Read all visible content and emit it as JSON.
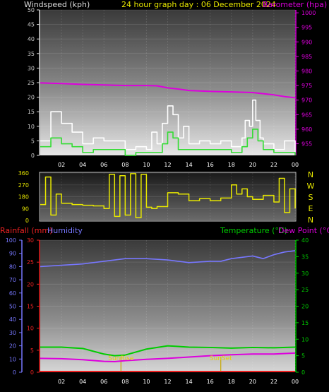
{
  "header": {
    "windspeed_label": "Windspeed (kph)",
    "title": "24 hour graph day : 06 December 2024",
    "barometer_label": "Barometer (hpa)",
    "rainfall_label": "Rainfall (mm)",
    "humidity_label": "Humidity",
    "temperature_label": "Temperature (°C)",
    "dewpoint_label": "Dew Point (°C)"
  },
  "compass_labels": [
    "N",
    "W",
    "S",
    "E",
    "N"
  ],
  "sun_labels": {
    "sunrise": "SunRise",
    "sunset": "SunSet"
  },
  "colors": {
    "wind": "#ffffff",
    "wind_avg": "#33dd33",
    "barometer": "#dd00dd",
    "direction": "#e8e800",
    "rain": "#ee2222",
    "humidity": "#7777ff",
    "temperature": "#00cc00",
    "dewpoint": "#dd00dd",
    "header_wind": "#dddddd",
    "header_title": "#e8e800"
  },
  "chart_data": [
    {
      "type": "line",
      "x_ticks": [
        "02",
        "04",
        "06",
        "08",
        "10",
        "12",
        "14",
        "16",
        "18",
        "20",
        "22",
        "00"
      ],
      "x_hours": [
        2,
        4,
        6,
        8,
        10,
        12,
        14,
        16,
        18,
        20,
        22,
        24
      ],
      "y_left_ticks": [
        "0",
        "5",
        "10",
        "15",
        "20",
        "25",
        "30",
        "35",
        "40",
        "45",
        "50"
      ],
      "y_left_range": [
        0,
        50
      ],
      "y_right_ticks": [
        "955",
        "960",
        "965",
        "970",
        "975",
        "980",
        "985",
        "990",
        "995",
        "1000"
      ],
      "y_right_range": [
        951,
        1001
      ],
      "grid": true,
      "series": [
        {
          "name": "Windspeed (kph)",
          "axis": "left",
          "x": [
            0,
            1,
            2,
            3,
            4,
            5,
            6,
            7,
            8,
            9,
            10,
            10.5,
            11,
            11.5,
            12,
            12.5,
            13,
            13.5,
            14,
            15,
            16,
            17,
            18,
            19,
            19.3,
            19.7,
            20,
            20.3,
            20.7,
            21,
            22,
            23,
            24
          ],
          "values": [
            5,
            15,
            11,
            8,
            4,
            6,
            5,
            5,
            2,
            3,
            2,
            8,
            4,
            11,
            17,
            14,
            6,
            10,
            4,
            5,
            4,
            5,
            3,
            6,
            12,
            10,
            19,
            12,
            6,
            4,
            2,
            5,
            1
          ]
        },
        {
          "name": "Wind average",
          "axis": "left",
          "x": [
            0,
            1,
            2,
            3,
            4,
            5,
            6,
            7,
            8,
            9,
            10,
            11,
            11.5,
            12,
            12.5,
            13,
            14,
            15,
            16,
            17,
            18,
            19,
            19.5,
            20,
            20.5,
            21,
            22,
            23,
            24
          ],
          "values": [
            3,
            6,
            4,
            3,
            1,
            2,
            2,
            2,
            0,
            1,
            1,
            1,
            4,
            8,
            6,
            2,
            2,
            2,
            2,
            2,
            1,
            3,
            6,
            9,
            5,
            2,
            1,
            1,
            0
          ]
        },
        {
          "name": "Barometer (hpa)",
          "axis": "right",
          "x": [
            0,
            2,
            4,
            6,
            8,
            10,
            11,
            12,
            13,
            14,
            16,
            18,
            20,
            22,
            23,
            24
          ],
          "values": [
            975.9,
            975.7,
            975.4,
            975.2,
            975,
            975,
            974.9,
            974.2,
            973.8,
            973.3,
            973,
            972.8,
            972.6,
            971.8,
            971.2,
            970.8
          ]
        }
      ]
    },
    {
      "type": "line",
      "x_ticks": [
        "02",
        "04",
        "06",
        "08",
        "10",
        "12",
        "14",
        "16",
        "18",
        "20",
        "22",
        "00"
      ],
      "y_left_ticks": [
        "0",
        "90",
        "180",
        "270",
        "360"
      ],
      "y_range": [
        0,
        360
      ],
      "series": [
        {
          "name": "Wind direction",
          "x": [
            0,
            0.5,
            1,
            1.5,
            2,
            3,
            4,
            5,
            6,
            6.5,
            7,
            7.5,
            8,
            8.5,
            9,
            9.5,
            10,
            10.5,
            11,
            12,
            13,
            14,
            15,
            16,
            17,
            18,
            18.5,
            19,
            19.5,
            20,
            21,
            22,
            22.5,
            23,
            23.5,
            24
          ],
          "values": [
            120,
            330,
            40,
            200,
            130,
            120,
            115,
            110,
            90,
            350,
            30,
            340,
            40,
            355,
            20,
            350,
            100,
            90,
            105,
            210,
            200,
            150,
            165,
            150,
            170,
            270,
            200,
            240,
            180,
            160,
            190,
            140,
            320,
            60,
            240,
            90
          ]
        }
      ]
    },
    {
      "type": "line",
      "x_ticks": [
        "02",
        "04",
        "06",
        "08",
        "10",
        "12",
        "14",
        "16",
        "18",
        "20",
        "22",
        "00"
      ],
      "y_humidity_ticks": [
        "0",
        "10",
        "20",
        "30",
        "40",
        "50",
        "60",
        "70",
        "80",
        "90",
        "100"
      ],
      "y_rain_ticks": [
        "0",
        "5",
        "10",
        "15",
        "20",
        "25",
        "30"
      ],
      "y_temp_ticks": [
        "0",
        "5",
        "10",
        "15",
        "20",
        "25",
        "30",
        "35",
        "40"
      ],
      "humidity_range": [
        0,
        100
      ],
      "rain_range": [
        0,
        30
      ],
      "temp_range": [
        0,
        40
      ],
      "grid": true,
      "sun_events": [
        {
          "label": "SunRise",
          "hour": 7.6
        },
        {
          "label": "SunSet",
          "hour": 17.0
        }
      ],
      "series": [
        {
          "name": "Humidity",
          "axis": "humidity",
          "x": [
            0,
            2,
            4,
            6,
            8,
            10,
            12,
            13,
            14,
            16,
            17,
            18,
            20,
            21,
            22,
            23,
            24
          ],
          "values": [
            80,
            81,
            82,
            84,
            86,
            86,
            85,
            84,
            83,
            84,
            84,
            86,
            88,
            86,
            89,
            91,
            92
          ]
        },
        {
          "name": "Rainfall (mm)",
          "axis": "rain",
          "x": [
            0,
            24
          ],
          "values": [
            0,
            0
          ]
        },
        {
          "name": "Temperature (°C)",
          "axis": "temp",
          "x": [
            0,
            2,
            4,
            6,
            7,
            8,
            10,
            12,
            13,
            14,
            16,
            18,
            20,
            22,
            24
          ],
          "values": [
            7.6,
            7.6,
            7.2,
            5.5,
            5,
            5.2,
            7,
            8,
            7.8,
            7.6,
            7.5,
            7.3,
            7.5,
            7.4,
            7.6
          ]
        },
        {
          "name": "Dew Point (°C)",
          "axis": "temp",
          "x": [
            0,
            2,
            4,
            6,
            7,
            8,
            10,
            12,
            14,
            16,
            18,
            20,
            22,
            24
          ],
          "values": [
            4.2,
            4.1,
            3.8,
            3.3,
            3.2,
            3.5,
            3.9,
            4.2,
            4.6,
            5,
            5.3,
            5.5,
            5.5,
            5.8
          ]
        }
      ]
    }
  ]
}
